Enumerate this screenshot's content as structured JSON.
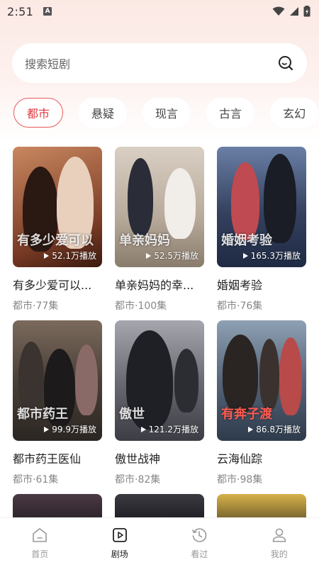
{
  "status_bar": {
    "time": "2:51",
    "notification_badge": "A"
  },
  "search": {
    "placeholder": "搜索短剧"
  },
  "categories": [
    {
      "label": "都市",
      "active": true
    },
    {
      "label": "悬疑",
      "active": false
    },
    {
      "label": "现言",
      "active": false
    },
    {
      "label": "古言",
      "active": false
    },
    {
      "label": "玄幻",
      "active": false
    }
  ],
  "dramas": [
    {
      "title": "有多少爱可以...",
      "meta": "都市·77集",
      "plays": "52.1万播放",
      "poster_text": "有多少爱可以",
      "palette": [
        "#7a3b25",
        "#c98860"
      ]
    },
    {
      "title": "单亲妈妈的幸...",
      "meta": "都市·100集",
      "plays": "52.5万播放",
      "poster_text": "单亲妈妈",
      "palette": [
        "#8a7c6c",
        "#d9cfc3"
      ]
    },
    {
      "title": "婚姻考验",
      "meta": "都市·76集",
      "plays": "165.3万播放",
      "poster_text": "婚姻考验",
      "palette": [
        "#1f2a44",
        "#6a7fa6"
      ]
    },
    {
      "title": "都市药王医仙",
      "meta": "都市·61集",
      "plays": "99.9万播放",
      "poster_text": "都市药王",
      "palette": [
        "#2b2622",
        "#7b6a5c"
      ]
    },
    {
      "title": "傲世战神",
      "meta": "都市·82集",
      "plays": "121.2万播放",
      "poster_text": "傲世",
      "palette": [
        "#3c3d44",
        "#a6a7ae"
      ]
    },
    {
      "title": "云海仙踪",
      "meta": "都市·98集",
      "plays": "86.8万播放",
      "poster_text": "有奔子渡",
      "palette": [
        "#2e3b4c",
        "#8ea0b3"
      ]
    }
  ],
  "bottom_nav": [
    {
      "label": "首页",
      "icon": "home-icon",
      "active": false
    },
    {
      "label": "剧场",
      "icon": "theater-icon",
      "active": true
    },
    {
      "label": "看过",
      "icon": "history-icon",
      "active": false
    },
    {
      "label": "我的",
      "icon": "profile-icon",
      "active": false
    }
  ],
  "colors": {
    "accent": "#e0393f",
    "background_top": "#fbe9e4"
  }
}
